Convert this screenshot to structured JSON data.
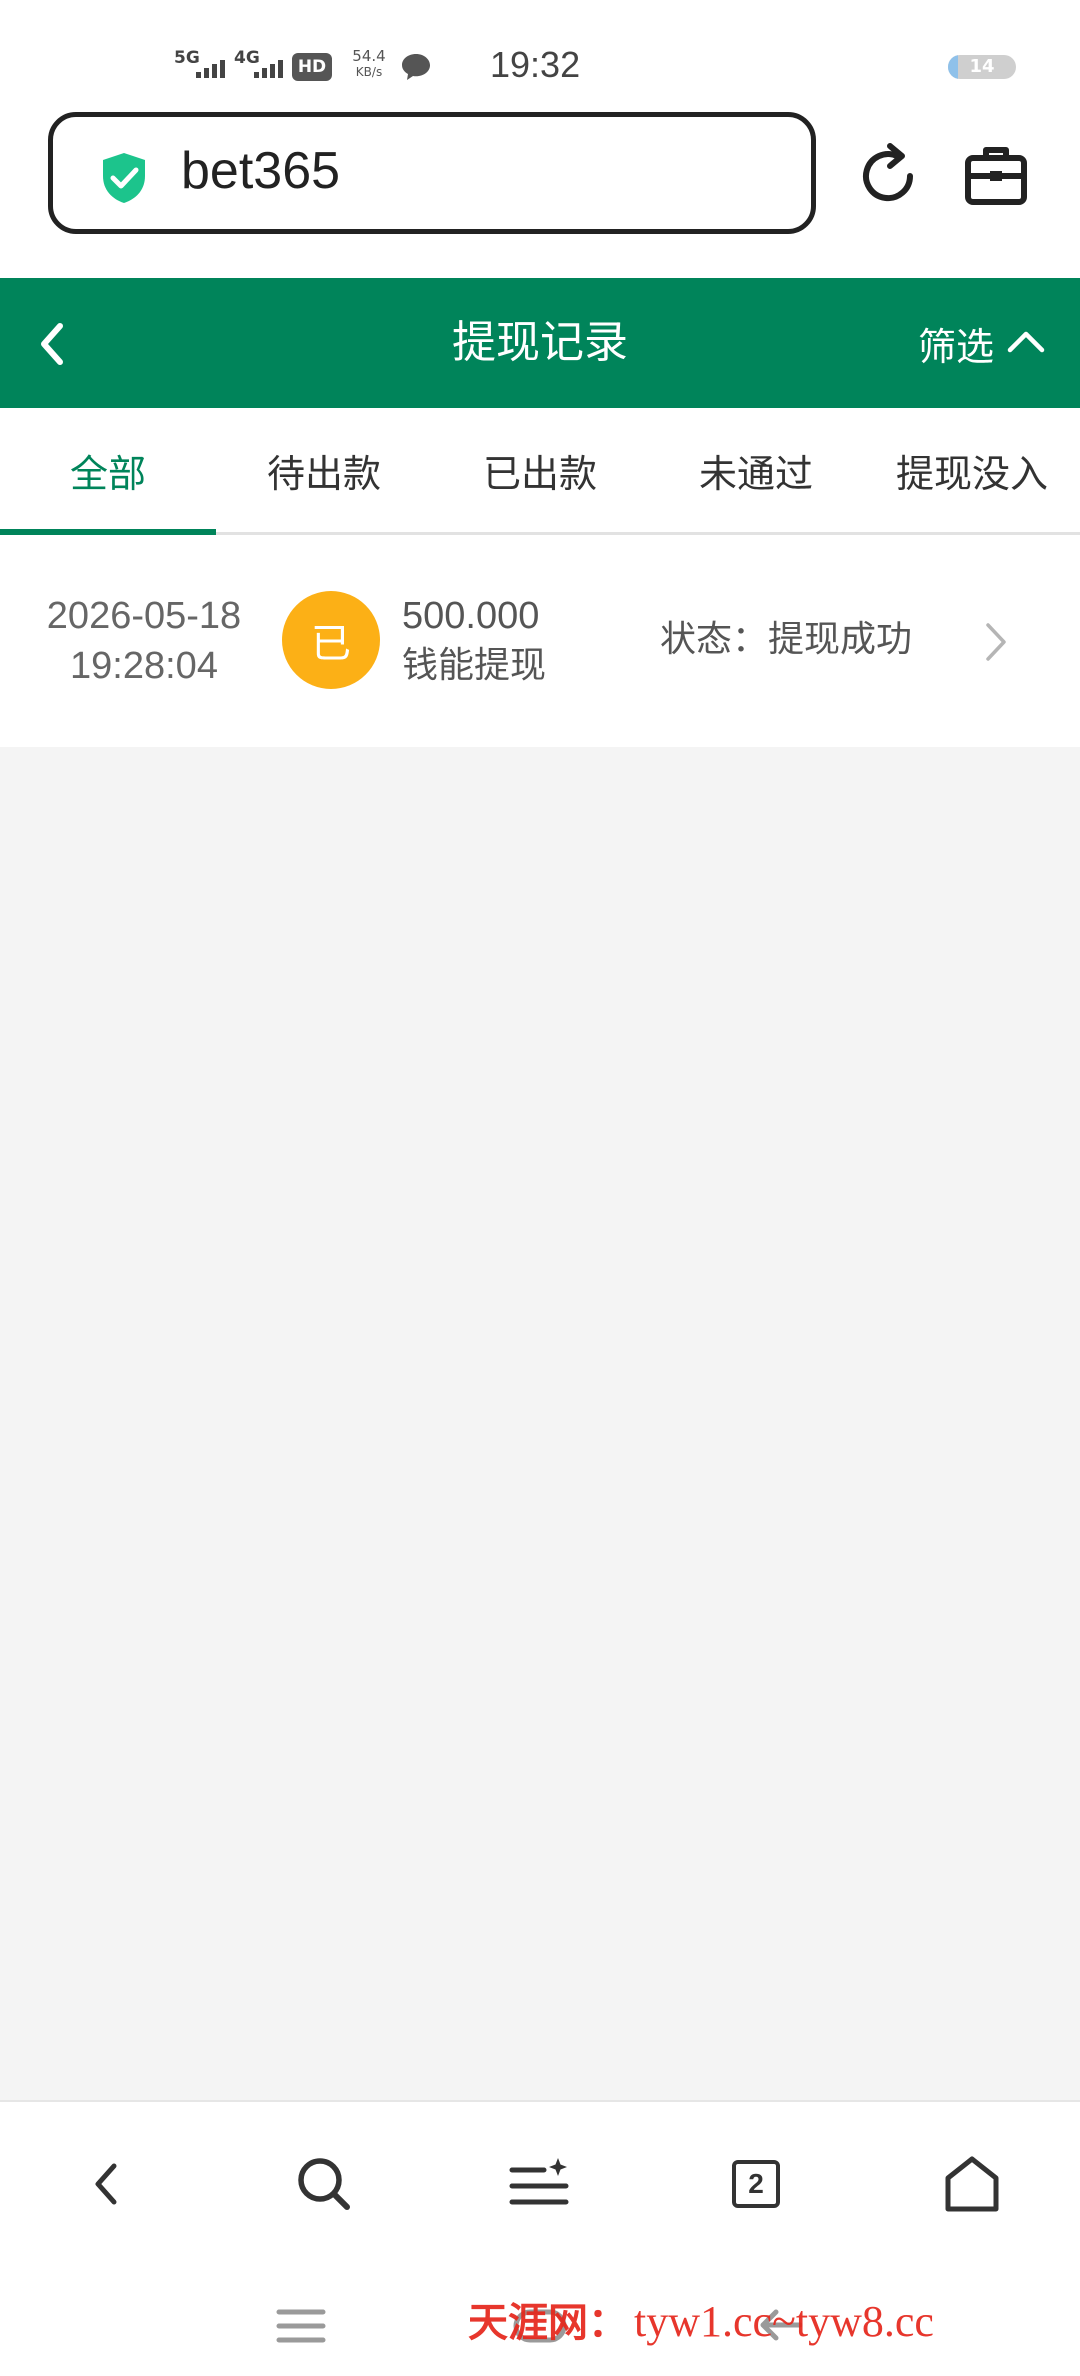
{
  "status_bar": {
    "net1": "5G",
    "net2": "4G",
    "hd_label": "HD",
    "speed_value": "54.4",
    "speed_unit": "KB/s",
    "time": "19:32",
    "battery": "14",
    "battery_level": 0.14
  },
  "browser": {
    "url": "bet365"
  },
  "header": {
    "title": "提现记录",
    "filter_label": "筛选"
  },
  "tabs": [
    {
      "label": "全部",
      "active": true
    },
    {
      "label": "待出款",
      "active": false
    },
    {
      "label": "已出款",
      "active": false
    },
    {
      "label": "未通过",
      "active": false
    },
    {
      "label": "提现没入",
      "active": false
    }
  ],
  "records": [
    {
      "date": "2026-05-18",
      "time": "19:28:04",
      "badge": "已",
      "amount": "500.000",
      "type": "钱能提现",
      "status": "状态：提现成功"
    }
  ],
  "bottom_nav": {
    "tab_count": "2"
  },
  "watermark": {
    "site_name": "天涯网：",
    "urls": "tyw1.cc~tyw8.cc"
  },
  "colors": {
    "brand_green": "#00845a",
    "badge_orange": "#fcb016",
    "shield_green": "#1cc48c",
    "watermark_red": "#e5261b"
  }
}
